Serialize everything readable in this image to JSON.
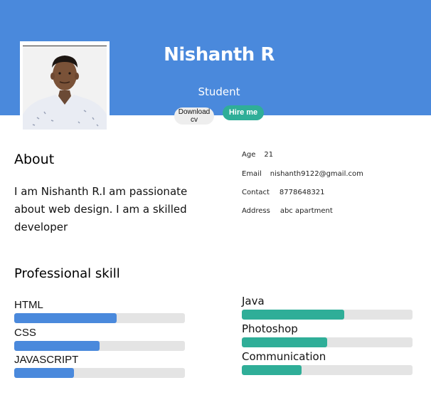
{
  "header": {
    "name": "Nishanth R",
    "role": "Student",
    "banner_color": "#4a89dc",
    "profile_photo": "profile-photo-icon",
    "download_cv_label": "Download cv",
    "hire_me_label": "Hire me",
    "hire_me_color": "#2fae98"
  },
  "about": {
    "title": "About",
    "text": "I am Nishanth R.I am passionate about web design. I am a skilled developer"
  },
  "info": {
    "age_label": "Age",
    "age_value": "21",
    "email_label": "Email",
    "email_value": "nishanth9122@gmail.com",
    "contact_label": "Contact",
    "contact_value": "8778648321",
    "address_label": "Address",
    "address_value": "abc apartment"
  },
  "skills": {
    "title": "Professional skill",
    "left_color": "#4a89dc",
    "right_color": "#2fae98",
    "items": [
      {
        "name": "HTML",
        "level": 60
      },
      {
        "name": "CSS",
        "level": 50
      },
      {
        "name": "JAVASCRIPT",
        "level": 35
      },
      {
        "name": "Java",
        "level": 60
      },
      {
        "name": "Photoshop",
        "level": 50
      },
      {
        "name": "Communication",
        "level": 35
      }
    ]
  }
}
